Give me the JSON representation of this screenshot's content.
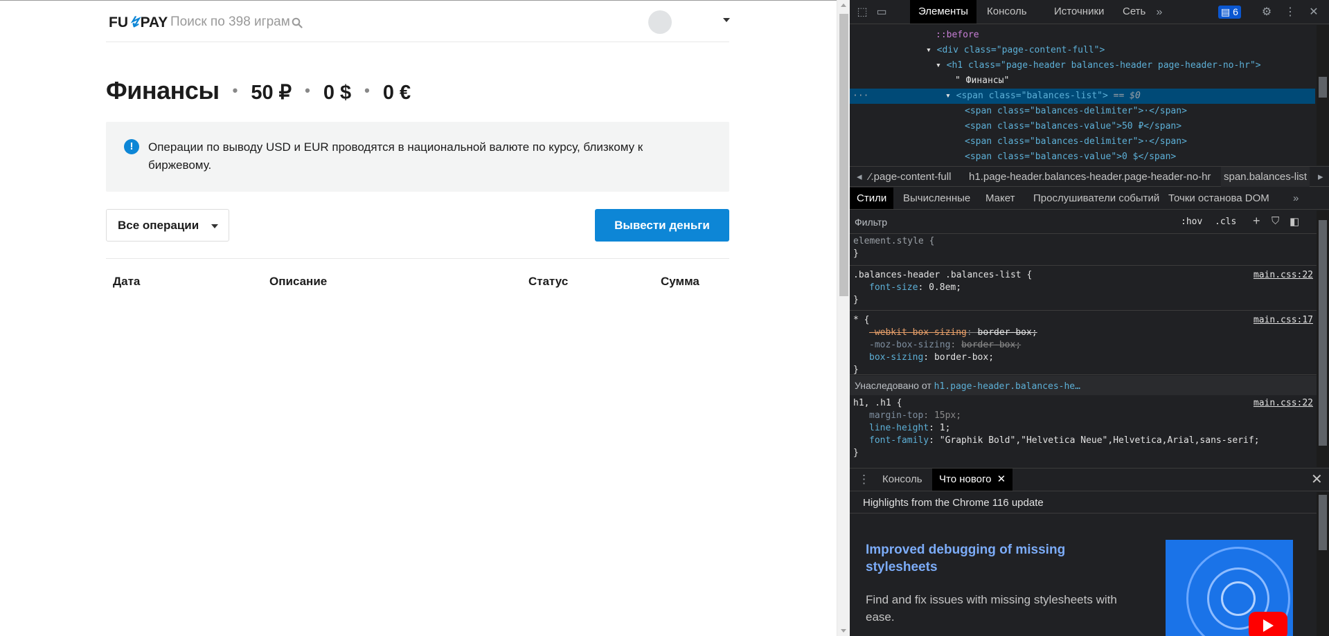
{
  "page": {
    "logo": "FUNPAY",
    "search_placeholder": "Поиск по 398 играм",
    "title": "Финансы",
    "balances": [
      "50 ₽",
      "0 $",
      "0 €"
    ],
    "balance_delimiter": "•",
    "notice": "Операции по выводу USD и EUR проводятся в национальной валюте по курсу, близкому к биржевому.",
    "filter_label": "Все операции",
    "withdraw_label": "Вывести деньги",
    "table_headers": [
      "Дата",
      "Описание",
      "Статус",
      "Сумма"
    ],
    "accent_color": "#0d86d6"
  },
  "devtools": {
    "tabs": [
      "Элементы",
      "Консоль",
      "Источники",
      "Сеть"
    ],
    "more": "»",
    "issues_count": "6",
    "dom": {
      "before": "::before",
      "div_open": "<div class=\"page-content-full\">",
      "h1_open": "<h1 class=\"page-header balances-header page-header-no-hr\">",
      "h1_text": "\" Финансы\"",
      "span_open": "<span class=\"balances-list\">",
      "span_eq": "== $0",
      "row1": "<span class=\"balances-delimiter\">·</span>",
      "row2": "<span class=\"balances-value\">50 ₽</span>",
      "row3": "<span class=\"balances-delimiter\">·</span>",
      "row4": "<span class=\"balances-value\">0 $</span>"
    },
    "breadcrumbs": [
      "⁄.page-content-full",
      "h1.page-header.balances-header.page-header-no-hr",
      "span.balances-list"
    ],
    "sub_tabs": [
      "Стили",
      "Вычисленные",
      "Макет",
      "Прослушиватели событий",
      "Точки останова DOM"
    ],
    "filter_placeholder": "Фильтр",
    "hov": ":hov",
    "cls": ".cls",
    "styles": {
      "element_style": "element.style {",
      "close": "}",
      "rule1_selector": ".balances-header .balances-list {",
      "rule1_prop": "font-size",
      "rule1_val": "0.8em;",
      "rule1_src": "main.css:22",
      "rule2_selector": "* {",
      "rule2_src": "main.css:17",
      "rule2_p1": "-webkit-box-sizing",
      "rule2_v1": "border-box;",
      "rule2_p2": "-moz-box-sizing",
      "rule2_v2": "border-box;",
      "rule2_p3": "box-sizing",
      "rule2_v3": "border-box;",
      "inherited_label": "Унаследовано от",
      "inherited_ref": "h1.page-header.balances-he…",
      "rule3_selector": "h1, .h1 {",
      "rule3_src": "main.css:22",
      "rule3_p1": "margin-top",
      "rule3_v1": "15px;",
      "rule3_p2": "line-height",
      "rule3_v2": "1;",
      "rule3_p3": "font-family",
      "rule3_v3": "\"Graphik Bold\",\"Helvetica Neue\",Helvetica,Arial,sans-serif;"
    },
    "drawer_tabs": [
      "Консоль",
      "Что нового"
    ],
    "whatsnew_heading": "Highlights from the Chrome 116 update",
    "whatsnew_title": "Improved debugging of missing stylesheets",
    "whatsnew_desc": "Find and fix issues with missing stylesheets with ease."
  }
}
